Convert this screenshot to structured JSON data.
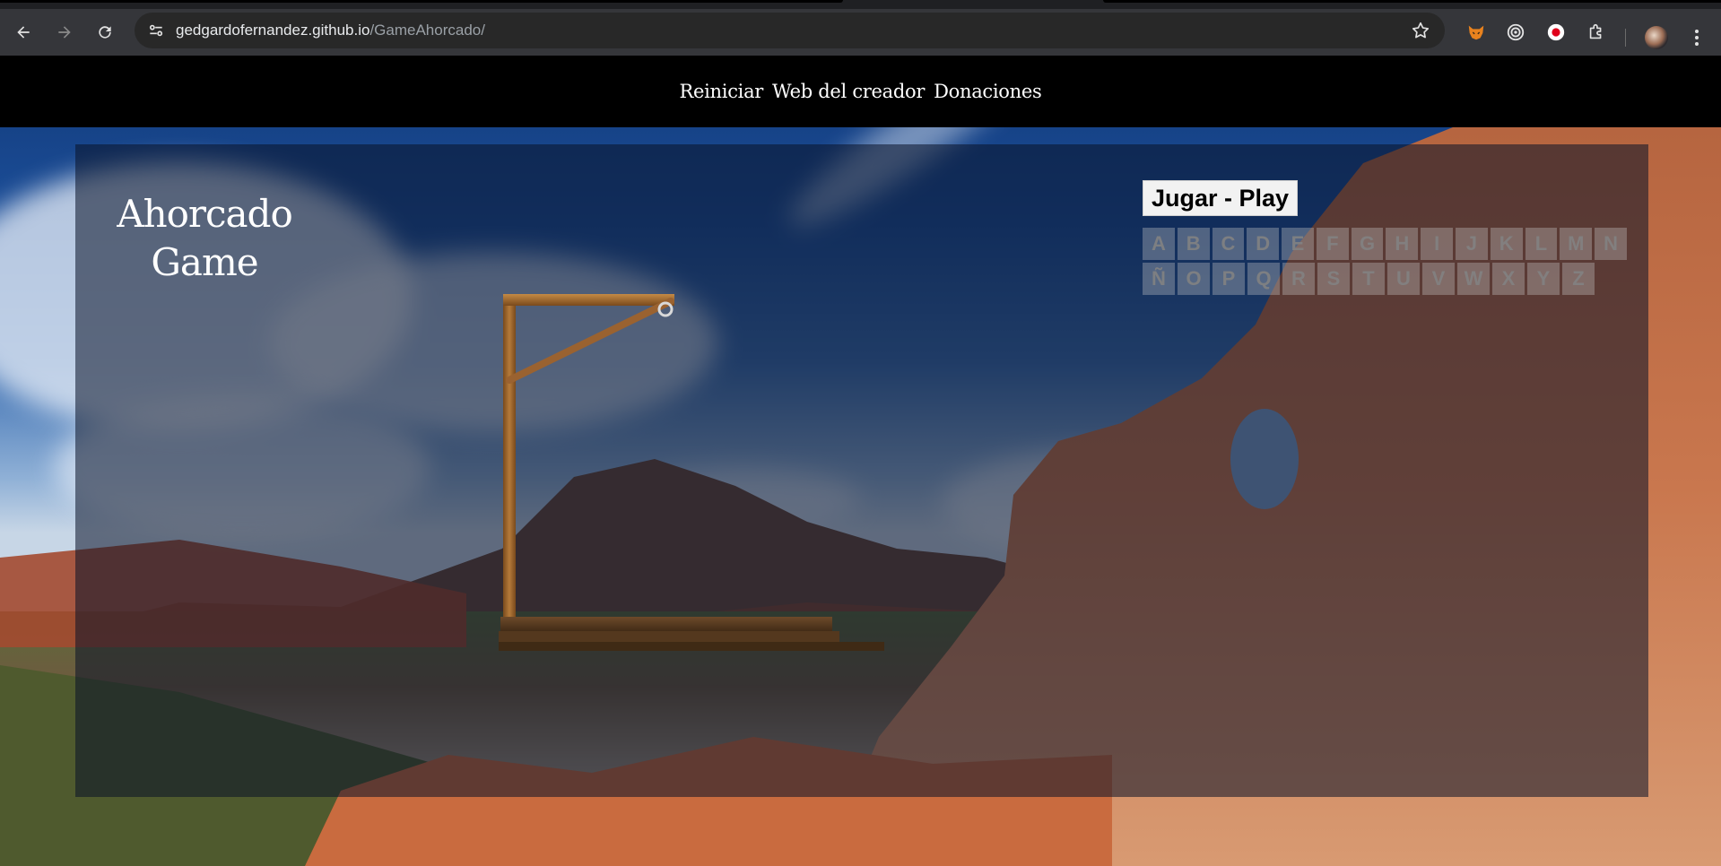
{
  "browser": {
    "url_host": "gedgardofernandez.github.io",
    "url_path": "/GameAhorcado/",
    "extensions": [
      "fox-extension-icon",
      "target-extension-icon",
      "record-extension-icon",
      "puzzle-extensions-icon"
    ]
  },
  "nav": {
    "restart": "Reiniciar",
    "creator": "Web del creador",
    "donations": "Donaciones"
  },
  "game": {
    "title_line1": "Ahorcado",
    "title_line2": "Game",
    "play_label": "Jugar - Play"
  },
  "keyboard": {
    "row1": [
      "A",
      "B",
      "C",
      "D",
      "E",
      "F",
      "G",
      "H",
      "I",
      "J",
      "K",
      "L",
      "M",
      "N"
    ],
    "row2": [
      "Ñ",
      "O",
      "P",
      "Q",
      "R",
      "S",
      "T",
      "U",
      "V",
      "W",
      "X",
      "Y",
      "Z"
    ]
  }
}
